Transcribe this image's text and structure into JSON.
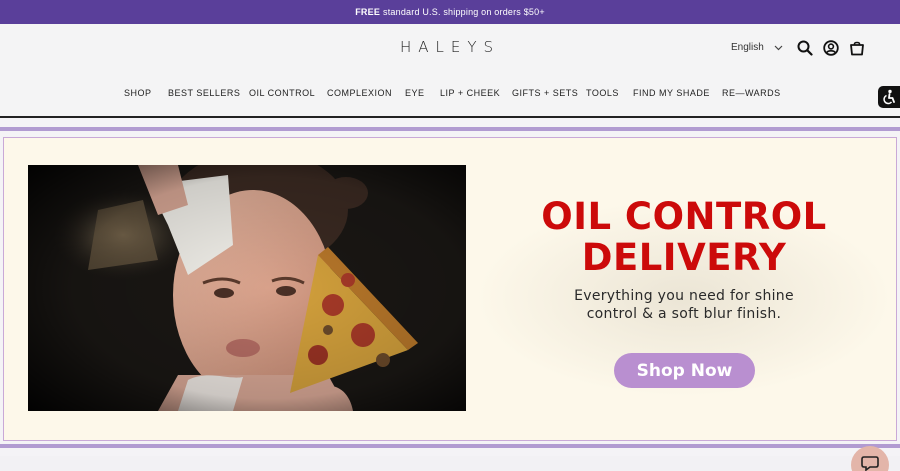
{
  "announcement": {
    "bold": "FREE",
    "text": "standard U.S. shipping on orders $50+"
  },
  "header": {
    "logo": "HALEYS",
    "language": "English",
    "icons": [
      "search-icon",
      "account-icon",
      "cart-icon"
    ]
  },
  "nav": {
    "items": [
      "SHOP",
      "BEST SELLERS",
      "OIL CONTROL",
      "COMPLEXION",
      "EYE",
      "LIP + CHEEK",
      "GIFTS + SETS",
      "TOOLS",
      "FIND MY SHADE",
      "RE—WARDS"
    ]
  },
  "hero": {
    "headline_line1": "OIL CONTROL",
    "headline_line2": "DELIVERY",
    "subtext_line1": "Everything you need for shine",
    "subtext_line2": "control & a soft blur finish.",
    "cta": "Shop Now",
    "image": "woman-with-blotting-paper-and-pizza-slice"
  },
  "colors": {
    "announcement_bg": "#5a3f9a",
    "headline": "#cc0a0a",
    "cta_bg": "#b98fd0",
    "hero_bg": "#fdf8ea",
    "stripe": "#b19bd1"
  }
}
